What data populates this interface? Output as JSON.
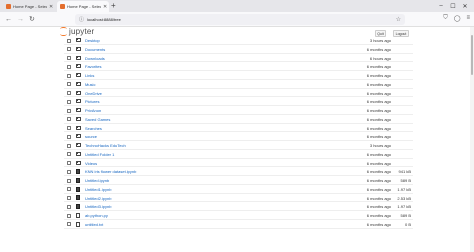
{
  "browser": {
    "tabs": [
      {
        "title": "Home Page - Select or create",
        "active": false
      },
      {
        "title": "Home Page - Select or create",
        "active": true
      }
    ],
    "url": "localhost:8888/tree",
    "newtab_icon": "+",
    "controls": [
      "–",
      "☐",
      "✕"
    ]
  },
  "header": {
    "logo_text": "jupyter",
    "quit_label": "Quit",
    "logout_label": "Logout"
  },
  "files": [
    {
      "type": "folder",
      "name": "Desktop",
      "modified": "3 hours ago",
      "size": ""
    },
    {
      "type": "folder",
      "name": "Documents",
      "modified": "6 months ago",
      "size": ""
    },
    {
      "type": "folder",
      "name": "Downloads",
      "modified": "6 hours ago",
      "size": ""
    },
    {
      "type": "folder",
      "name": "Favorites",
      "modified": "6 months ago",
      "size": ""
    },
    {
      "type": "folder",
      "name": "Links",
      "modified": "6 months ago",
      "size": ""
    },
    {
      "type": "folder",
      "name": "Music",
      "modified": "6 months ago",
      "size": ""
    },
    {
      "type": "folder",
      "name": "OneDrive",
      "modified": "6 months ago",
      "size": ""
    },
    {
      "type": "folder",
      "name": "Pictures",
      "modified": "6 months ago",
      "size": ""
    },
    {
      "type": "folder",
      "name": "PrivAnon",
      "modified": "6 months ago",
      "size": ""
    },
    {
      "type": "folder",
      "name": "Saved Games",
      "modified": "6 months ago",
      "size": ""
    },
    {
      "type": "folder",
      "name": "Searches",
      "modified": "6 months ago",
      "size": ""
    },
    {
      "type": "folder",
      "name": "source",
      "modified": "6 months ago",
      "size": ""
    },
    {
      "type": "folder",
      "name": "TechnoHacks EduTech",
      "modified": "3 hours ago",
      "size": ""
    },
    {
      "type": "folder",
      "name": "Untitled Folder 1",
      "modified": "6 months ago",
      "size": ""
    },
    {
      "type": "folder",
      "name": "Videos",
      "modified": "6 months ago",
      "size": ""
    },
    {
      "type": "notebook",
      "name": "KNN iris flower dataset.ipynb",
      "modified": "6 months ago",
      "size": "941 kB"
    },
    {
      "type": "notebook",
      "name": "Untitled.ipynb",
      "modified": "6 months ago",
      "size": "589 B"
    },
    {
      "type": "notebook",
      "name": "Untitled1.ipynb",
      "modified": "6 months ago",
      "size": "1.97 kB"
    },
    {
      "type": "notebook",
      "name": "Untitled2.ipynb",
      "modified": "6 months ago",
      "size": "2.53 kB"
    },
    {
      "type": "notebook",
      "name": "Untitled3.ipynb",
      "modified": "6 months ago",
      "size": "1.97 kB"
    },
    {
      "type": "file",
      "name": "ab.python.py",
      "modified": "6 months ago",
      "size": "589 B"
    },
    {
      "type": "file",
      "name": "untitled.txt",
      "modified": "6 months ago",
      "size": "0 B"
    }
  ]
}
